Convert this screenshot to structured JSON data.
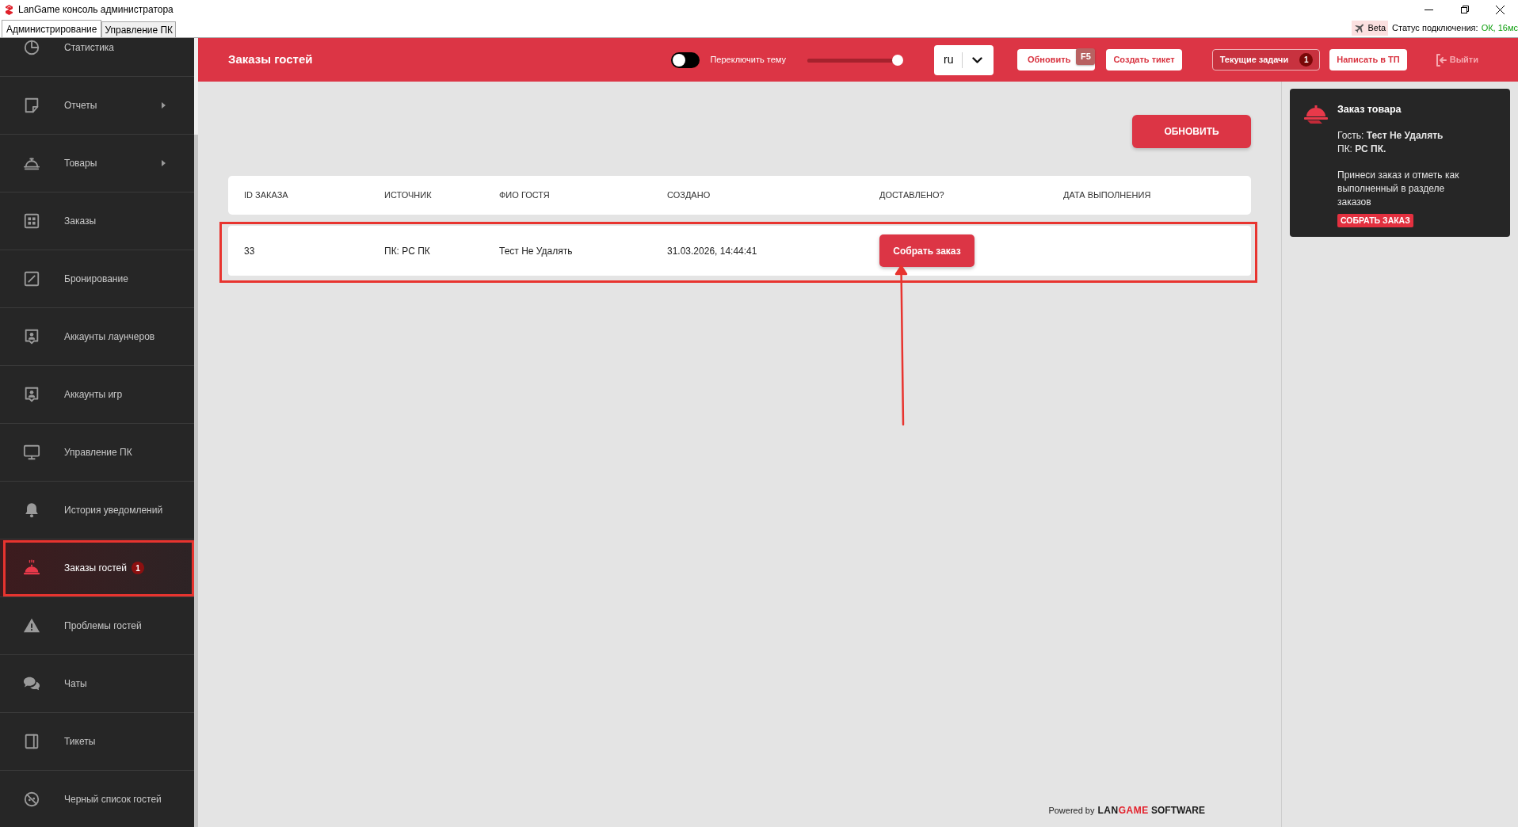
{
  "window": {
    "title": "LanGame консоль администратора"
  },
  "app_tabs": [
    {
      "label": "Администрирование",
      "selected": true
    },
    {
      "label": "Управление ПК",
      "selected": false
    }
  ],
  "status_bar": {
    "beta": "Beta",
    "connection_label": "Статус подключения:",
    "connection_value": "ОК, 16мс"
  },
  "sidebar": {
    "items": [
      {
        "label": "Статистика",
        "submenu": false,
        "selected": false
      },
      {
        "label": "Отчеты",
        "submenu": true,
        "selected": false
      },
      {
        "label": "Товары",
        "submenu": true,
        "selected": false
      },
      {
        "label": "Заказы",
        "submenu": false,
        "selected": false
      },
      {
        "label": "Бронирование",
        "submenu": false,
        "selected": false
      },
      {
        "label": "Аккаунты лаунчеров",
        "submenu": false,
        "selected": false
      },
      {
        "label": "Аккаунты игр",
        "submenu": false,
        "selected": false
      },
      {
        "label": "Управление ПК",
        "submenu": false,
        "selected": false
      },
      {
        "label": "История уведомлений",
        "submenu": false,
        "selected": false
      },
      {
        "label": "Заказы гостей",
        "submenu": false,
        "selected": true,
        "badge": "1"
      },
      {
        "label": "Проблемы гостей",
        "submenu": false,
        "selected": false
      },
      {
        "label": "Чаты",
        "submenu": false,
        "selected": false
      },
      {
        "label": "Тикеты",
        "submenu": false,
        "selected": false
      },
      {
        "label": "Черный список гостей",
        "submenu": false,
        "selected": false
      }
    ]
  },
  "header": {
    "title": "Заказы гостей",
    "theme_toggle": {
      "label": "Переключить тему",
      "on": false
    },
    "slider": {
      "level": 0.95
    },
    "language": {
      "value": "ru"
    },
    "buttons": [
      {
        "kind": "light",
        "label": "Обновить",
        "shortcut": "F5"
      },
      {
        "kind": "light",
        "label": "Создать тикет"
      },
      {
        "kind": "outline",
        "label": "Текущие задачи",
        "badge": "1"
      },
      {
        "kind": "light",
        "label": "Написать в ТП"
      },
      {
        "kind": "exit",
        "label": "Выйти"
      }
    ]
  },
  "page": {
    "refresh_button": "ОБНОВИТЬ",
    "table": {
      "columns": [
        "ID ЗАКАЗА",
        "ИСТОЧНИК",
        "ФИО ГОСТЯ",
        "СОЗДАНО",
        "ДОСТАВЛЕНО?",
        "ДАТА ВЫПОЛНЕНИЯ"
      ],
      "rows": [
        {
          "id": "33",
          "source": "ПК: РС ПК",
          "guest": "Тест Не Удалять",
          "created": "31.03.2026, 14:44:41",
          "delivered_action": "Собрать заказ"
        }
      ]
    }
  },
  "notification": {
    "title": "Заказ товара",
    "guest": "Гость: **Тест Не Удалять**",
    "pc": "ПК: **РС ПК.**",
    "message": "Принеси заказ и отметь как выполненный в разделе заказов",
    "action": "СОБРАТЬ ЗАКАЗ"
  },
  "footer": {
    "prefix": "Powered by",
    "logo": [
      {
        "kind": "dark",
        "text": "LAN"
      },
      {
        "kind": "accent",
        "text": "GAME"
      }
    ],
    "logo_suffix": "SOFTWARE"
  }
}
